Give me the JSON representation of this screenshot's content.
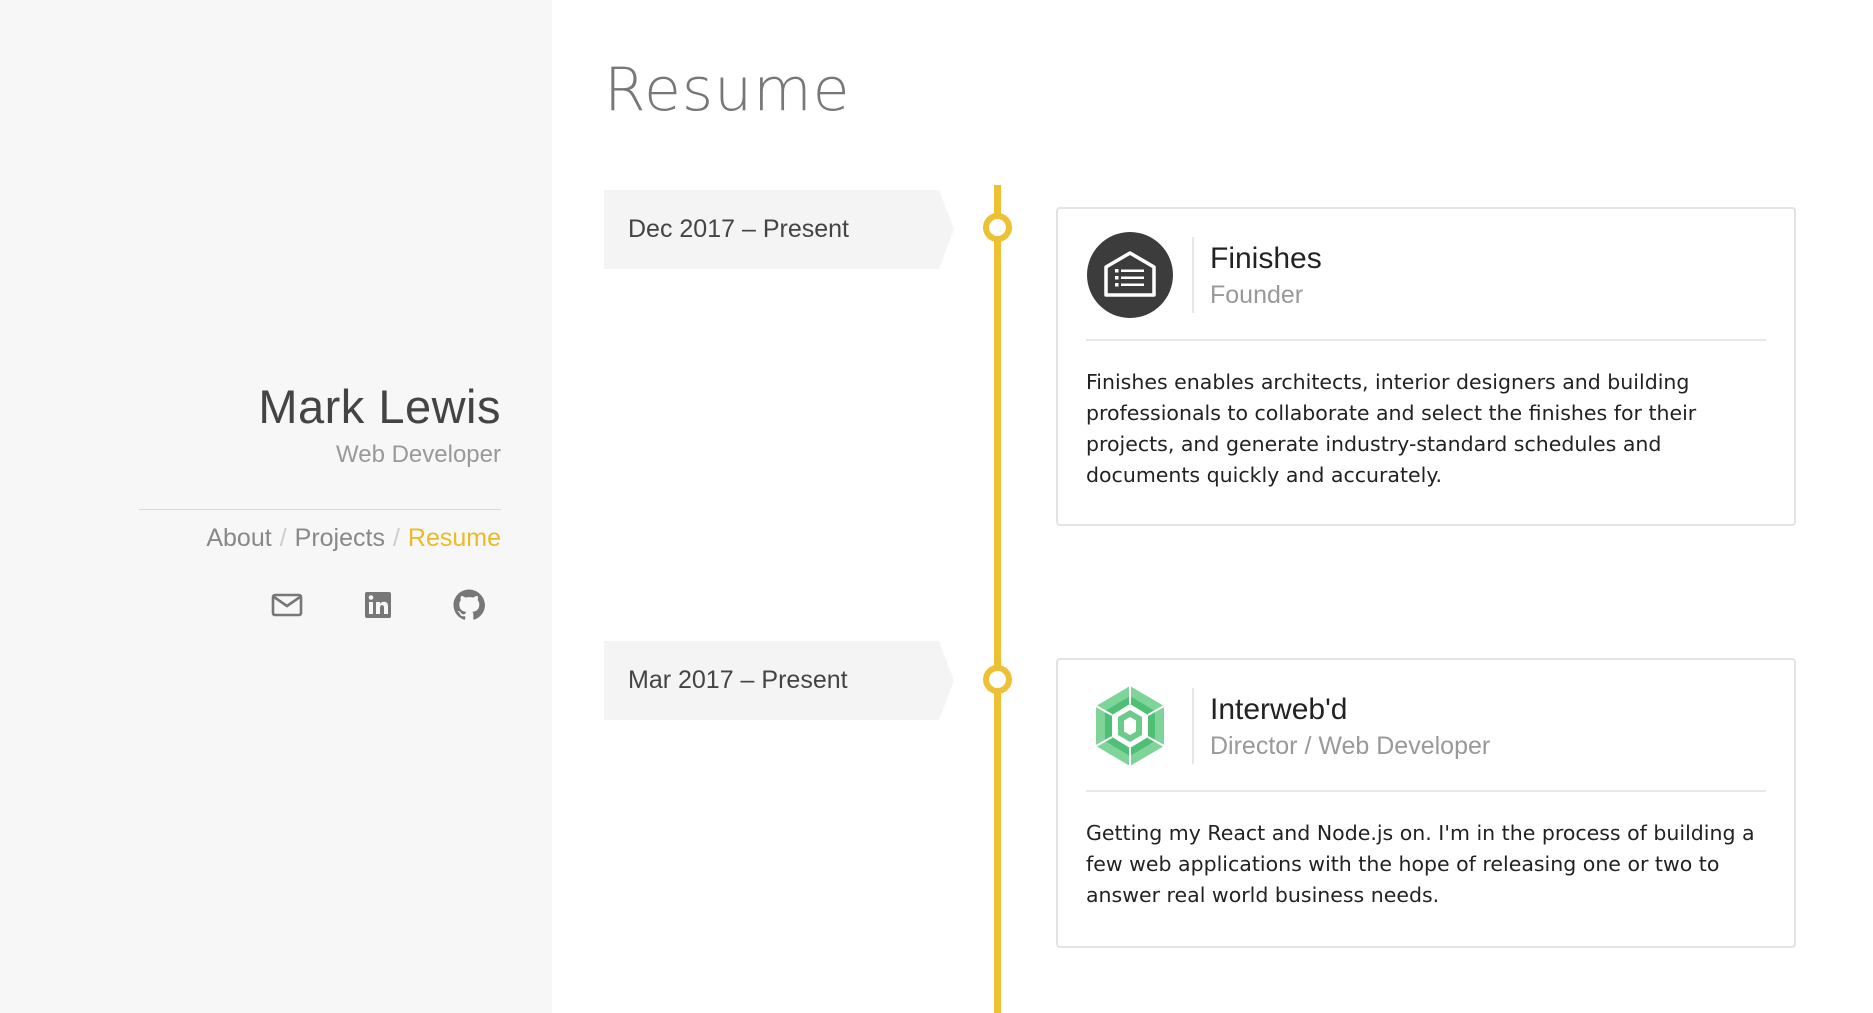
{
  "sidebar": {
    "name": "Mark Lewis",
    "role": "Web Developer",
    "nav": [
      {
        "label": "About",
        "active": false
      },
      {
        "label": "Projects",
        "active": false
      },
      {
        "label": "Resume",
        "active": true
      }
    ],
    "nav_separator": "/",
    "socials": [
      {
        "icon": "mail-icon"
      },
      {
        "icon": "linkedin-icon"
      },
      {
        "icon": "github-icon"
      }
    ]
  },
  "main": {
    "title": "Resume",
    "entries": [
      {
        "date": "Dec 2017 – Present",
        "company": "Finishes",
        "position": "Founder",
        "logo_icon": "finishes-logo-icon",
        "description": "Finishes enables architects, interior designers and building professionals to collaborate and select the finishes for their projects, and generate industry-standard schedules and documents quickly and accurately."
      },
      {
        "date": "Mar 2017 – Present",
        "company": "Interweb'd",
        "position": "Director / Web Developer",
        "logo_icon": "interwebd-logo-icon",
        "description": "Getting my React and Node.js on. I'm in the process of building a few web applications with the hope of releasing one or two to answer real world business needs."
      }
    ]
  },
  "colors": {
    "accent": "#eec034",
    "sidebar_bg": "#f7f7f7"
  }
}
